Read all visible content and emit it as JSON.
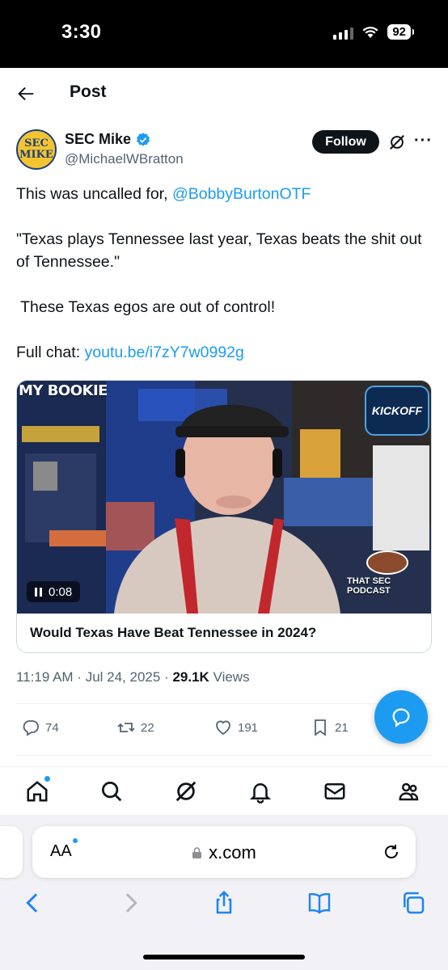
{
  "status_bar": {
    "time": "3:30",
    "battery": "92"
  },
  "header": {
    "title": "Post"
  },
  "author": {
    "name": "SEC Mike",
    "handle": "@MichaelWBratton",
    "avatar_line1": "SEC",
    "avatar_line2": "MIKE",
    "follow_label": "Follow"
  },
  "tweet": {
    "line1_text": "This was uncalled for, ",
    "mention": "@BobbyBurtonOTF",
    "quote": "\"Texas plays Tennessee last year, Texas beats the shit out of Tennessee.\"",
    "line3": " These Texas egos are out of control!",
    "chat_label": "Full chat: ",
    "link": "youtu.be/i7zY7w0992g"
  },
  "video_card": {
    "title": "Would Texas Have Beat Tennessee in 2024?",
    "duration": "0:08",
    "overlay_brand": "MY BOOKIE",
    "overlay_logo": "KICKOFF",
    "overlay_podcast": "THAT SEC PODCAST"
  },
  "meta": {
    "time": "11:19 AM",
    "date": "Jul 24, 2025",
    "views_count": "29.1K",
    "views_label": "Views"
  },
  "actions": {
    "replies": "74",
    "reposts": "22",
    "likes": "191",
    "bookmarks": "21"
  },
  "tabbar": {
    "items": [
      "home-icon",
      "search-icon",
      "grok-icon",
      "notifications-icon",
      "messages-icon",
      "communities-icon"
    ]
  },
  "safari": {
    "aa_label": "AA",
    "url": "x.com"
  },
  "colors": {
    "accent": "#1d9bf0",
    "text": "#0f1419",
    "secondary": "#536471"
  }
}
